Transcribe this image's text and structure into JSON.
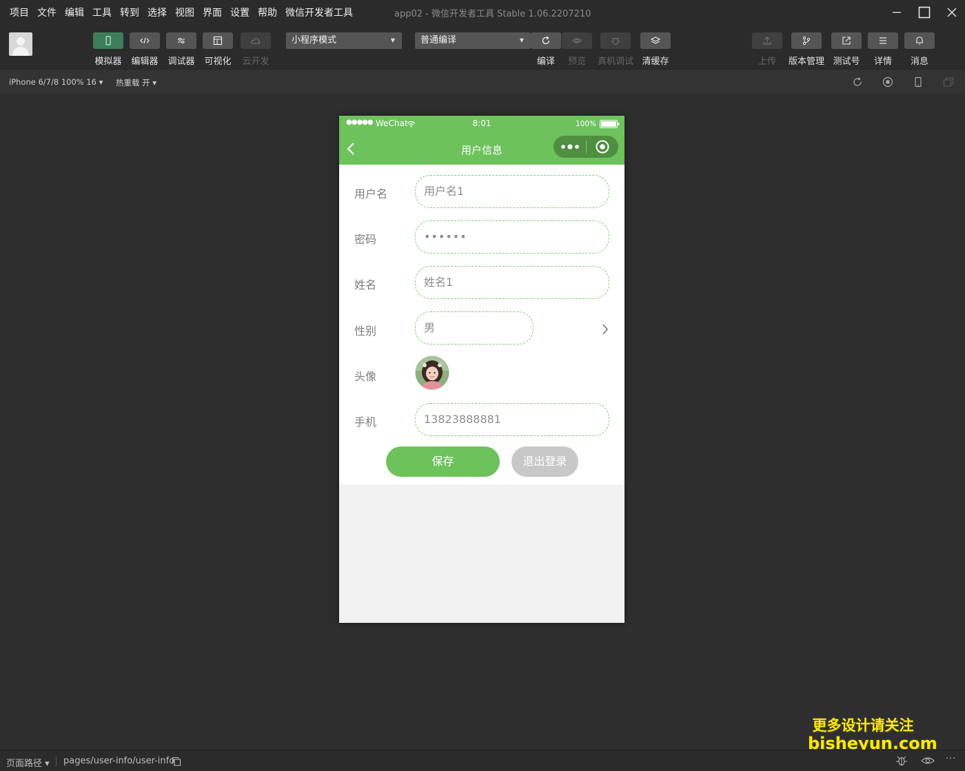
{
  "menu": [
    "项目",
    "文件",
    "编辑",
    "工具",
    "转到",
    "选择",
    "视图",
    "界面",
    "设置",
    "帮助",
    "微信开发者工具"
  ],
  "window_title": "app02 - 微信开发者工具 Stable 1.06.2207210",
  "toolbar": {
    "mode_buttons": [
      {
        "label": "模拟器",
        "icon": "phone-icon",
        "state": "active"
      },
      {
        "label": "编辑器",
        "icon": "code-icon",
        "state": "normal"
      },
      {
        "label": "调试器",
        "icon": "debug-icon",
        "state": "normal"
      },
      {
        "label": "可视化",
        "icon": "layout-icon",
        "state": "normal"
      },
      {
        "label": "云开发",
        "icon": "cloud-icon",
        "state": "disabled"
      }
    ],
    "mode_select": "小程序模式",
    "compile_select": "普通编译",
    "action_buttons": [
      {
        "label": "编译",
        "icon": "refresh-icon",
        "state": "normal"
      },
      {
        "label": "预览",
        "icon": "eye-icon",
        "state": "disabled"
      },
      {
        "label": "真机调试",
        "icon": "bug-icon",
        "state": "disabled"
      },
      {
        "label": "清缓存",
        "icon": "layers-icon",
        "state": "normal"
      }
    ],
    "right_buttons": [
      {
        "label": "上传",
        "icon": "upload-icon",
        "state": "disabled"
      },
      {
        "label": "版本管理",
        "icon": "branch-icon",
        "state": "normal"
      },
      {
        "label": "测试号",
        "icon": "external-link-icon",
        "state": "normal"
      },
      {
        "label": "详情",
        "icon": "list-icon",
        "state": "normal"
      },
      {
        "label": "消息",
        "icon": "bell-icon",
        "state": "normal"
      }
    ]
  },
  "subbar": {
    "device": "iPhone 6/7/8 100% 16 ▾",
    "hot_reload": "热重载 开 ▾"
  },
  "phone": {
    "status": {
      "carrier": "WeChat",
      "time": "8:01",
      "battery": "100%"
    },
    "nav_title": "用户信息",
    "fields": [
      {
        "label": "用户名",
        "value": "用户名1"
      },
      {
        "label": "密码",
        "value": "••••••"
      },
      {
        "label": "姓名",
        "value": "姓名1"
      },
      {
        "label": "性别",
        "value": "男"
      },
      {
        "label": "头像",
        "value": ""
      },
      {
        "label": "手机",
        "value": "13823888881"
      }
    ],
    "save_label": "保存",
    "logout_label": "退出登录"
  },
  "bottombar": {
    "page_path_label": "页面路径 ▾",
    "page_path": "pages/user-info/user-info"
  },
  "watermark": {
    "line1": "更多设计请关注",
    "line2": "bisheyun.com"
  },
  "colors": {
    "accent": "#6dc25c",
    "active_tab": "#3c7d5b",
    "logout": "#c8c8c8"
  }
}
